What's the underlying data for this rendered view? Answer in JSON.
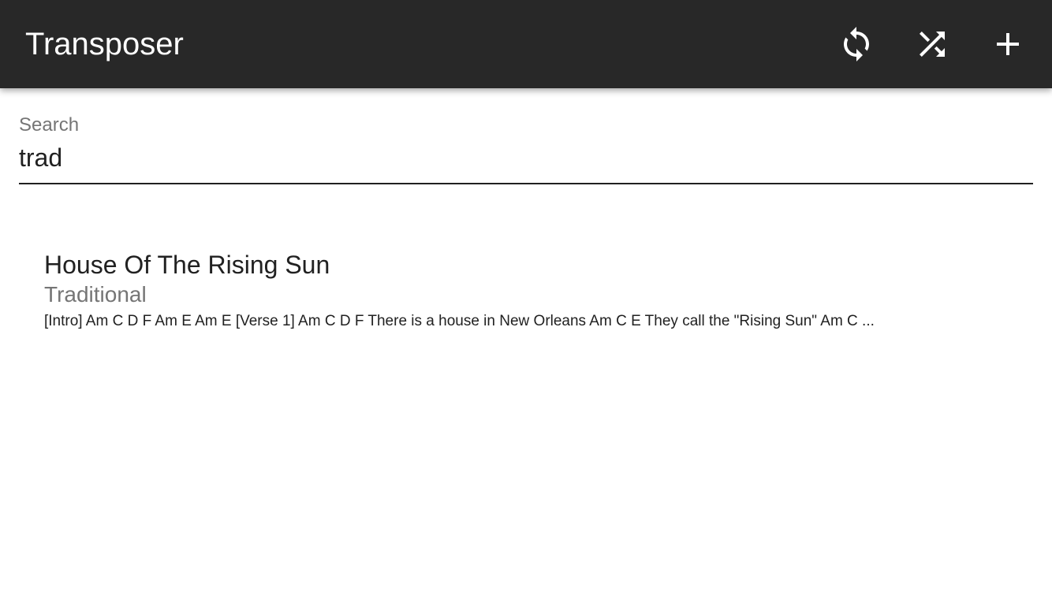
{
  "toolbar": {
    "title": "Transposer",
    "actions": [
      {
        "icon": "sync-icon"
      },
      {
        "icon": "shuffle-icon"
      },
      {
        "icon": "add-icon"
      }
    ],
    "background": "#282828",
    "icon_color": "#ffffff"
  },
  "search": {
    "label": "Search",
    "value": "trad"
  },
  "songs": [
    {
      "title": "House Of The Rising Sun",
      "artist": "Traditional",
      "preview": "[Intro] Am C D F Am E Am E [Verse 1] Am C D F There is a house in New Orleans Am C E They call the \"Rising Sun\" Am C ..."
    }
  ]
}
